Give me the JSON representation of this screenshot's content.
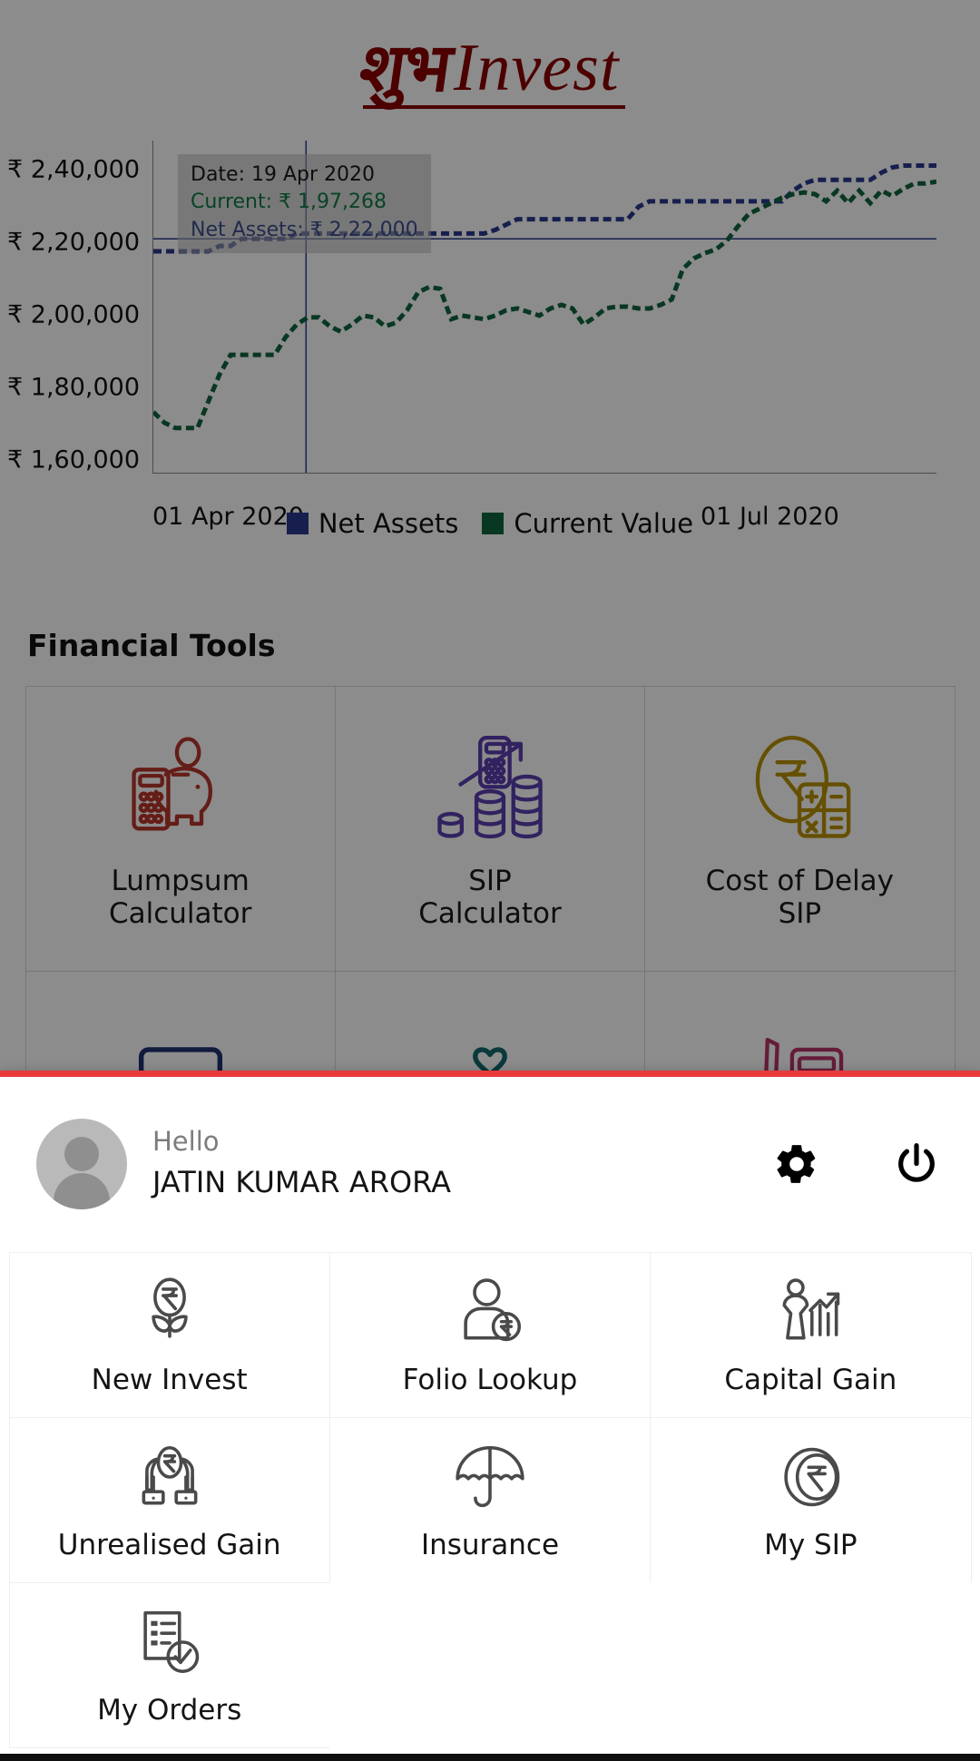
{
  "brand": {
    "devanagari": "शुभ",
    "word": "Invest"
  },
  "chart_data": {
    "type": "line",
    "title": "",
    "xlabel": "",
    "ylabel": "",
    "ylim": [
      155000,
      248000
    ],
    "ytick_labels": [
      "₹ 2,40,000",
      "₹ 2,20,000",
      "₹ 2,00,000",
      "₹ 1,80,000",
      "₹ 1,60,000"
    ],
    "ytick_values": [
      240000,
      220000,
      200000,
      180000,
      160000
    ],
    "xtick_labels": [
      "01 Apr 2020",
      "01 Jul 2020"
    ],
    "grid": false,
    "legend_position": "bottom",
    "tooltip": {
      "date_label": "Date: 19 Apr 2020",
      "current_label": "Current: ₹ 1,97,268",
      "net_assets_label": "Net Assets: ₹ 2,22,000"
    },
    "series": [
      {
        "name": "Net Assets",
        "color": "#2b3a8f",
        "values": [
          217000,
          217000,
          217000,
          217000,
          217000,
          217000,
          218500,
          218500,
          220500,
          220500,
          220500,
          220500,
          220500,
          222000,
          222000,
          222000,
          222000,
          222000,
          222000,
          222000,
          222000,
          222000,
          222000,
          222000,
          222000,
          222000,
          222000,
          222000,
          222000,
          222000,
          222000,
          223000,
          224500,
          226000,
          226000,
          226000,
          226000,
          226000,
          226000,
          226000,
          226000,
          226000,
          226000,
          226000,
          229500,
          231000,
          231000,
          231000,
          231000,
          231000,
          231000,
          231000,
          231000,
          231000,
          231000,
          231000,
          231000,
          231000,
          234000,
          236000,
          237000,
          237000,
          237000,
          237000,
          237000,
          237000,
          239000,
          240500,
          241000,
          241000,
          241000,
          241000
        ]
      },
      {
        "name": "Current Value",
        "color": "#10663f",
        "values": [
          172000,
          169000,
          167500,
          167500,
          167500,
          175000,
          182500,
          188000,
          188000,
          188000,
          188000,
          188000,
          193000,
          196500,
          198500,
          198500,
          196000,
          194500,
          196500,
          199000,
          198500,
          196000,
          197000,
          200500,
          205500,
          207000,
          206500,
          198000,
          199000,
          198500,
          198000,
          199000,
          200500,
          201000,
          200000,
          199000,
          201000,
          202000,
          201000,
          196500,
          198500,
          201000,
          201500,
          201500,
          201000,
          201000,
          202000,
          203500,
          212000,
          215000,
          216500,
          217500,
          220000,
          224000,
          227500,
          229000,
          230500,
          232000,
          233000,
          233500,
          233000,
          231000,
          234000,
          230500,
          234000,
          230500,
          234000,
          232500,
          234500,
          236000,
          236000,
          236500
        ]
      }
    ],
    "reference_line": {
      "value": 220500,
      "color": "#2b3a8f"
    },
    "cursor_line": {
      "label": "19 Apr 2020",
      "color": "#2b3a8f",
      "x_fraction": 0.195
    }
  },
  "financial_tools": {
    "section_title": "Financial Tools",
    "items": [
      {
        "label": "Lumpsum\nCalculator",
        "line1": "Lumpsum",
        "line2": "Calculator",
        "icon": "piggy-bank-calculator-icon",
        "color": "#b8362a"
      },
      {
        "label": "SIP\nCalculator",
        "line1": "SIP",
        "line2": "Calculator",
        "icon": "calculator-coins-growth-icon",
        "color": "#5b3fb0"
      },
      {
        "label": "Cost of Delay\nSIP",
        "line1": "Cost of Delay",
        "line2": "SIP",
        "icon": "rupee-calculator-icon",
        "color": "#b99100"
      },
      {
        "label": "",
        "line1": "",
        "line2": "",
        "icon": "blue-card-icon",
        "color": "#1f3271"
      },
      {
        "label": "",
        "line1": "",
        "line2": "",
        "icon": "teal-heart-people-icon",
        "color": "#15696e"
      },
      {
        "label": "",
        "line1": "",
        "line2": "",
        "icon": "pink-pen-calculator-icon",
        "color": "#b8336a"
      }
    ]
  },
  "drawer": {
    "accent_color": "#e8393c",
    "greeting": "Hello",
    "user_name": "JATIN KUMAR ARORA",
    "avatar_name": "avatar",
    "settings_icon": "gear-icon",
    "power_icon": "power-icon",
    "menu_items": [
      {
        "label": "New Invest",
        "icon": "rupee-flower-icon"
      },
      {
        "label": "Folio Lookup",
        "icon": "person-rupee-icon"
      },
      {
        "label": "Capital Gain",
        "icon": "person-bar-chart-arrow-icon"
      },
      {
        "label": "Unrealised Gain",
        "icon": "hands-rupee-icon"
      },
      {
        "label": "Insurance",
        "icon": "umbrella-icon"
      },
      {
        "label": "My SIP",
        "icon": "rupee-coin-icon"
      },
      {
        "label": "My Orders",
        "icon": "checklist-icon"
      }
    ]
  }
}
